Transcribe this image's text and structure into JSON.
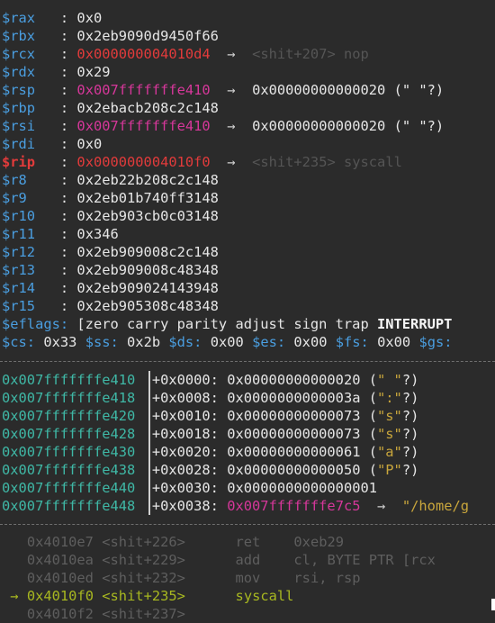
{
  "registers": [
    {
      "name": "$rax",
      "value": "0x0"
    },
    {
      "name": "$rbx",
      "value": "0x2eb9090d9450f66"
    },
    {
      "name": "$rcx",
      "value": "0x000000004010d4",
      "changed": true,
      "arrow": "→",
      "symbol": "<shit+207> nop"
    },
    {
      "name": "$rdx",
      "value": "0x29"
    },
    {
      "name": "$rsp",
      "value": "0x007fffffffe410",
      "ptr": true,
      "arrow": "→",
      "deref": "0x00000000000020 (\" \"?)"
    },
    {
      "name": "$rbp",
      "value": "0x2ebacb208c2c148"
    },
    {
      "name": "$rsi",
      "value": "0x007fffffffe410",
      "ptr": true,
      "arrow": "→",
      "deref": "0x00000000000020 (\" \"?)"
    },
    {
      "name": "$rdi",
      "value": "0x0"
    },
    {
      "name": "$rip",
      "value": "0x000000004010f0",
      "changed": true,
      "rip": true,
      "arrow": "→",
      "symbol": "<shit+235> syscall"
    },
    {
      "name": "$r8",
      "value": "0x2eb22b208c2c148"
    },
    {
      "name": "$r9",
      "value": "0x2eb01b740ff3148"
    },
    {
      "name": "$r10",
      "value": "0x2eb903cb0c03148"
    },
    {
      "name": "$r11",
      "value": "0x346"
    },
    {
      "name": "$r12",
      "value": "0x2eb909008c2c148"
    },
    {
      "name": "$r13",
      "value": "0x2eb909008c48348"
    },
    {
      "name": "$r14",
      "value": "0x2eb909024143948"
    },
    {
      "name": "$r15",
      "value": "0x2eb905308c48348"
    }
  ],
  "eflags": {
    "label": "$eflags:",
    "value_pre": " [zero carry parity adjust sign trap ",
    "value_bold": "INTERRUPT"
  },
  "segments": [
    {
      "name": "$cs:",
      "value": " 0x33 "
    },
    {
      "name": "$ss:",
      "value": " 0x2b "
    },
    {
      "name": "$ds:",
      "value": " 0x00 "
    },
    {
      "name": "$es:",
      "value": " 0x00 "
    },
    {
      "name": "$fs:",
      "value": " 0x00 "
    },
    {
      "name": "$gs:",
      "value": ""
    }
  ],
  "stack": [
    {
      "addr": "0x007fffffffe410",
      "offset": "+0x0000:",
      "value": " 0x00000000000020 (",
      "chr": "\" \"",
      "tail": "?)"
    },
    {
      "addr": "0x007fffffffe418",
      "offset": "+0x0008:",
      "value": " 0x0000000000003a (",
      "chr": "\":\"",
      "tail": "?)"
    },
    {
      "addr": "0x007fffffffe420",
      "offset": "+0x0010:",
      "value": " 0x00000000000073 (",
      "chr": "\"s\"",
      "tail": "?)"
    },
    {
      "addr": "0x007fffffffe428",
      "offset": "+0x0018:",
      "value": " 0x00000000000073 (",
      "chr": "\"s\"",
      "tail": "?)"
    },
    {
      "addr": "0x007fffffffe430",
      "offset": "+0x0020:",
      "value": " 0x00000000000061 (",
      "chr": "\"a\"",
      "tail": "?)"
    },
    {
      "addr": "0x007fffffffe438",
      "offset": "+0x0028:",
      "value": " 0x00000000000050 (",
      "chr": "\"P\"",
      "tail": "?)"
    },
    {
      "addr": "0x007fffffffe440",
      "offset": "+0x0030:",
      "value": " 0x0000000000000001",
      "chr": "",
      "tail": ""
    },
    {
      "addr": "0x007fffffffe448",
      "offset": "+0x0038:",
      "ptrvalue": "0x007fffffffe7c5",
      "arrow": "→",
      "string": "\"/home/g"
    }
  ],
  "disasm": [
    {
      "marker": "",
      "addr": "0x4010e7",
      "sym": "<shit+226>",
      "mnem": "ret",
      "ops": "0xeb29"
    },
    {
      "marker": "",
      "addr": "0x4010ea",
      "sym": "<shit+229>",
      "mnem": "add",
      "ops": "cl, BYTE PTR [rcx"
    },
    {
      "marker": "",
      "addr": "0x4010ed",
      "sym": "<shit+232>",
      "mnem": "mov",
      "ops": "rsi, rsp"
    },
    {
      "marker": "→",
      "addr": "0x4010f0",
      "sym": "<shit+235>",
      "mnem": "syscall",
      "ops": "",
      "current": true
    },
    {
      "marker": "",
      "addr": "0x4010f2",
      "sym": "<shit+237>",
      "mnem": "",
      "ops": ""
    }
  ]
}
